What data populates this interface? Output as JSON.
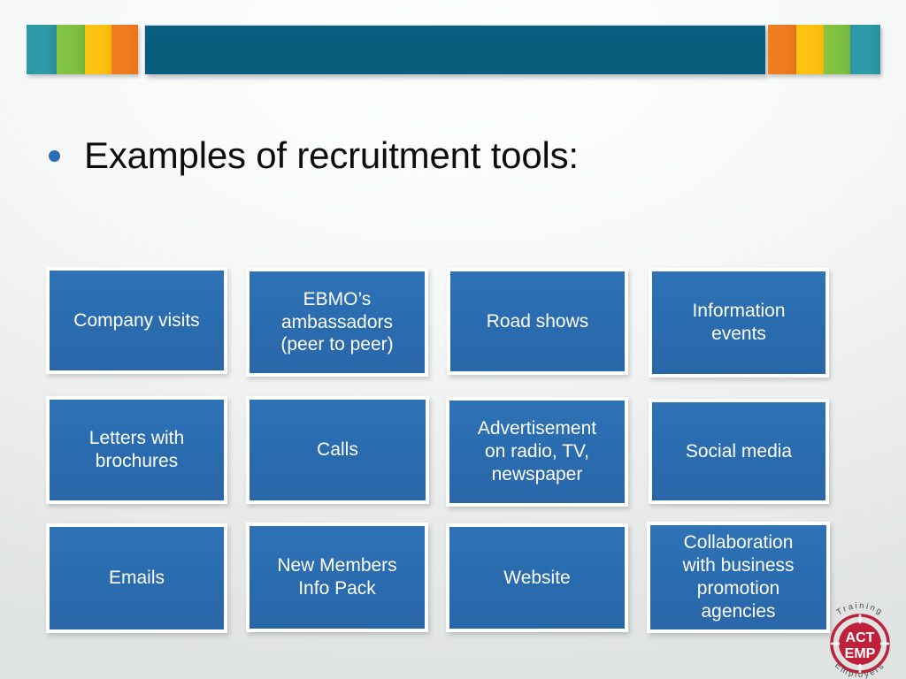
{
  "slide": {
    "title": "Examples of recruitment tools:",
    "bullet_color": "#2a6db3",
    "background_colors": [
      "#ffffff",
      "#eceeed",
      "#dfe3e1"
    ]
  },
  "header": {
    "bar_color": "#08597a",
    "stripes_left": [
      {
        "name": "teal-stripe",
        "color": "#2d98a6"
      },
      {
        "name": "green-stripe",
        "color": "#82c342"
      },
      {
        "name": "yellow-stripe",
        "color": "#fdc40f"
      },
      {
        "name": "orange-stripe",
        "color": "#f07d22"
      }
    ],
    "stripes_right": [
      {
        "name": "orange-stripe",
        "color": "#f07d22"
      },
      {
        "name": "yellow-stripe",
        "color": "#fdc40f"
      },
      {
        "name": "green-stripe",
        "color": "#82c342"
      },
      {
        "name": "teal-stripe",
        "color": "#2d98a6"
      }
    ]
  },
  "tools": {
    "box_color": "#2a6cb0",
    "text_color": "#ffffff",
    "items": [
      {
        "id": "company-visits",
        "label": "Company visits"
      },
      {
        "id": "ebmo-ambassadors",
        "label": "EBMO’s\nambassadors\n(peer to peer)"
      },
      {
        "id": "road-shows",
        "label": "Road shows"
      },
      {
        "id": "information-events",
        "label": "Information\nevents"
      },
      {
        "id": "letters-with-brochures",
        "label": "Letters with\nbrochures"
      },
      {
        "id": "calls",
        "label": "Calls"
      },
      {
        "id": "advertisement",
        "label": "Advertisement\non radio, TV,\nnewspaper"
      },
      {
        "id": "social-media",
        "label": "Social media"
      },
      {
        "id": "emails",
        "label": "Emails"
      },
      {
        "id": "new-members-info-pack",
        "label": "New Members\nInfo Pack"
      },
      {
        "id": "website",
        "label": "Website"
      },
      {
        "id": "collaboration",
        "label": "Collaboration\nwith business\npromotion\nagencies"
      }
    ]
  },
  "logo": {
    "center_line1": "ACT",
    "center_line2": "EMP",
    "arc_top": "Training",
    "arc_bottom": "Employers",
    "color": "#c0213a",
    "arc_text_color": "#4a4a4a"
  }
}
